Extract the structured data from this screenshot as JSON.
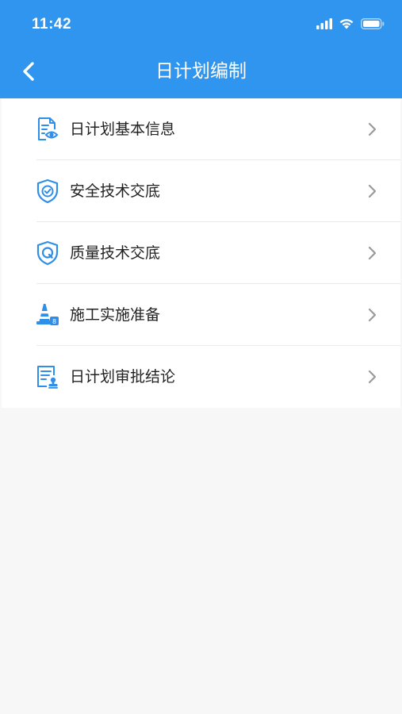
{
  "status_bar": {
    "time": "11:42",
    "icons": [
      "signal-icon",
      "wifi-icon",
      "battery-icon"
    ]
  },
  "nav": {
    "title": "日计划编制",
    "back_icon": "chevron-left-icon"
  },
  "theme": {
    "header_color": "#2f95ee",
    "icon_color": "#2f8fe8",
    "background": "#f7f7f7"
  },
  "menu": {
    "items": [
      {
        "label": "日计划基本信息",
        "icon": "document-eye-icon"
      },
      {
        "label": "安全技术交底",
        "icon": "shield-check-icon"
      },
      {
        "label": "质量技术交底",
        "icon": "shield-q-icon"
      },
      {
        "label": "施工实施准备",
        "icon": "traffic-cone-icon"
      },
      {
        "label": "日计划审批结论",
        "icon": "document-stamp-icon"
      }
    ]
  }
}
